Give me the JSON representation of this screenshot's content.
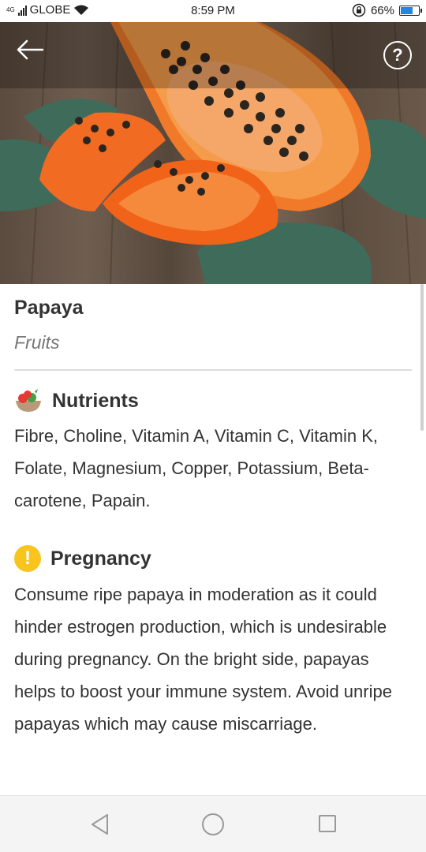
{
  "status_bar": {
    "network": "4G",
    "carrier": "GLOBE",
    "time": "8:59 PM",
    "battery_percent": "66%",
    "battery_level": 0.66,
    "wifi_icon": "wifi-icon",
    "lock_icon": "rotation-lock-icon"
  },
  "header": {
    "back_icon": "back-arrow-icon",
    "help_label": "?"
  },
  "food": {
    "title": "Papaya",
    "category": "Fruits"
  },
  "sections": {
    "nutrients": {
      "icon": "fruit-bowl-icon",
      "title": "Nutrients",
      "body": "Fibre, Choline, Vitamin A, Vitamin C, Vitamin K, Folate, Magnesium, Copper, Potassium, Beta-carotene, Papain."
    },
    "pregnancy": {
      "icon": "warning-icon",
      "icon_glyph": "!",
      "title": "Pregnancy",
      "body": "Consume ripe papaya in moderation as it could hinder estrogen production, which is undesirable during pregnancy. On the bright side, papayas helps to boost your immune system. Avoid unripe papayas which may cause miscarriage."
    }
  },
  "colors": {
    "warning": "#f7c51e",
    "battery_fill": "#1e88e5"
  }
}
